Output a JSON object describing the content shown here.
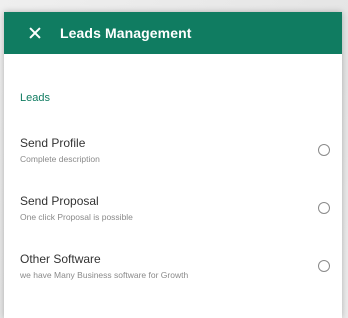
{
  "header": {
    "title": "Leads Management",
    "close_icon": "close-icon"
  },
  "section": {
    "label": "Leads"
  },
  "options": [
    {
      "title": "Send Profile",
      "description": "Complete description",
      "selected": false
    },
    {
      "title": "Send Proposal",
      "description": "One click Proposal is possible",
      "selected": false
    },
    {
      "title": "Other Software",
      "description": "we have Many Business software for Growth",
      "selected": false
    }
  ],
  "colors": {
    "accent": "#107c61",
    "background": "#ffffff"
  }
}
